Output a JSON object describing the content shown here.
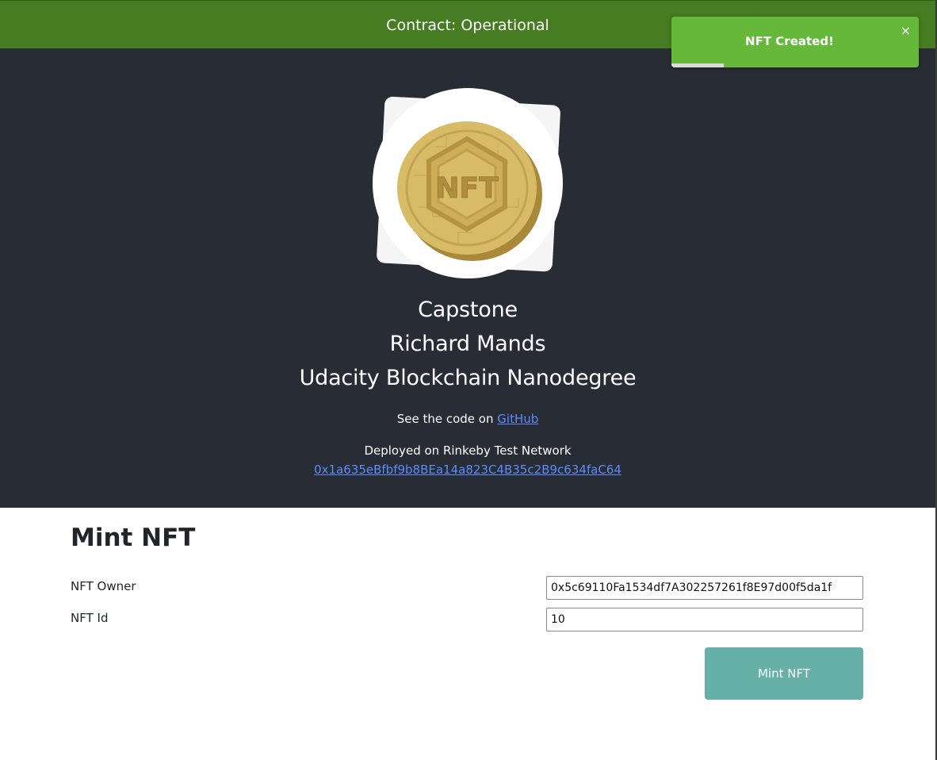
{
  "header": {
    "title": "Contract: Operational"
  },
  "toast": {
    "message": "NFT Created!",
    "close_label": "×",
    "progress": 0.21
  },
  "hero": {
    "logo_text": "NFT",
    "lines": [
      "Capstone",
      "Richard Mands",
      "Udacity Blockchain Nanodegree"
    ],
    "code_prefix": "See the code on",
    "code_link": "GitHub",
    "deployed_text": "Deployed on Rinkeby Test Network",
    "contract_address": "0x1a635eBfbf9b8BEa14a823C4B35c2B9c634faC64"
  },
  "mint": {
    "title": "Mint NFT",
    "owner_label": "NFT Owner",
    "owner_value": "0x5c69110Fa1534df7A302257261f8E97d00f5da1f",
    "id_label": "NFT Id",
    "id_value": "10",
    "button_label": "Mint NFT"
  },
  "colors": {
    "header": "#467c22",
    "hero_bg": "#282c34",
    "toast": "#66b83b",
    "button": "#66b0a8",
    "link": "#5b8cff"
  }
}
